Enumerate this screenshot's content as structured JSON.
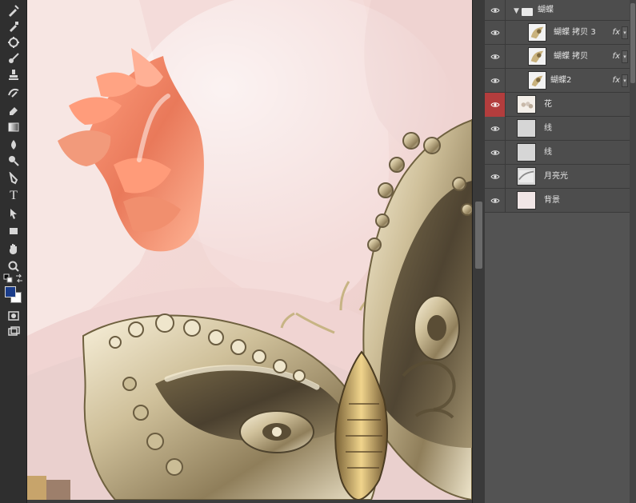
{
  "layers_panel": {
    "rows": [
      {
        "label": "蝴蝶",
        "type": "group",
        "visible": true
      },
      {
        "label": "蝴蝶 拷贝 3",
        "type": "layer",
        "fx": "fx",
        "visible": true
      },
      {
        "label": "蝴蝶 拷贝",
        "type": "layer",
        "fx": "fx",
        "visible": true
      },
      {
        "label": "蝴蝶2",
        "type": "layer",
        "fx": "fx",
        "visible": true
      },
      {
        "label": "花",
        "type": "layer",
        "visible": true,
        "active": true
      },
      {
        "label": "线",
        "type": "layer",
        "visible": true
      },
      {
        "label": "线",
        "type": "layer",
        "visible": true
      },
      {
        "label": "月亮光",
        "type": "layer",
        "visible": true
      },
      {
        "label": "背景",
        "type": "layer",
        "visible": true
      }
    ]
  },
  "tools": [
    {
      "name": "pen-tool-icon"
    },
    {
      "name": "eyedropper-icon"
    },
    {
      "name": "spot-heal-icon"
    },
    {
      "name": "brush-icon"
    },
    {
      "name": "stamp-icon"
    },
    {
      "name": "history-brush-icon"
    },
    {
      "name": "eraser-icon"
    },
    {
      "name": "gradient-icon"
    },
    {
      "name": "blur-icon"
    },
    {
      "name": "dodge-icon"
    },
    {
      "name": "pen-icon"
    },
    {
      "name": "type-icon",
      "glyph": "T"
    },
    {
      "name": "path-select-icon"
    },
    {
      "name": "shape-icon"
    },
    {
      "name": "hand-icon"
    },
    {
      "name": "zoom-icon"
    }
  ],
  "colors": {
    "foreground": "#1a3c8a",
    "background": "#ffffff",
    "panel": "#535353",
    "active_eye": "#b33d3d"
  }
}
